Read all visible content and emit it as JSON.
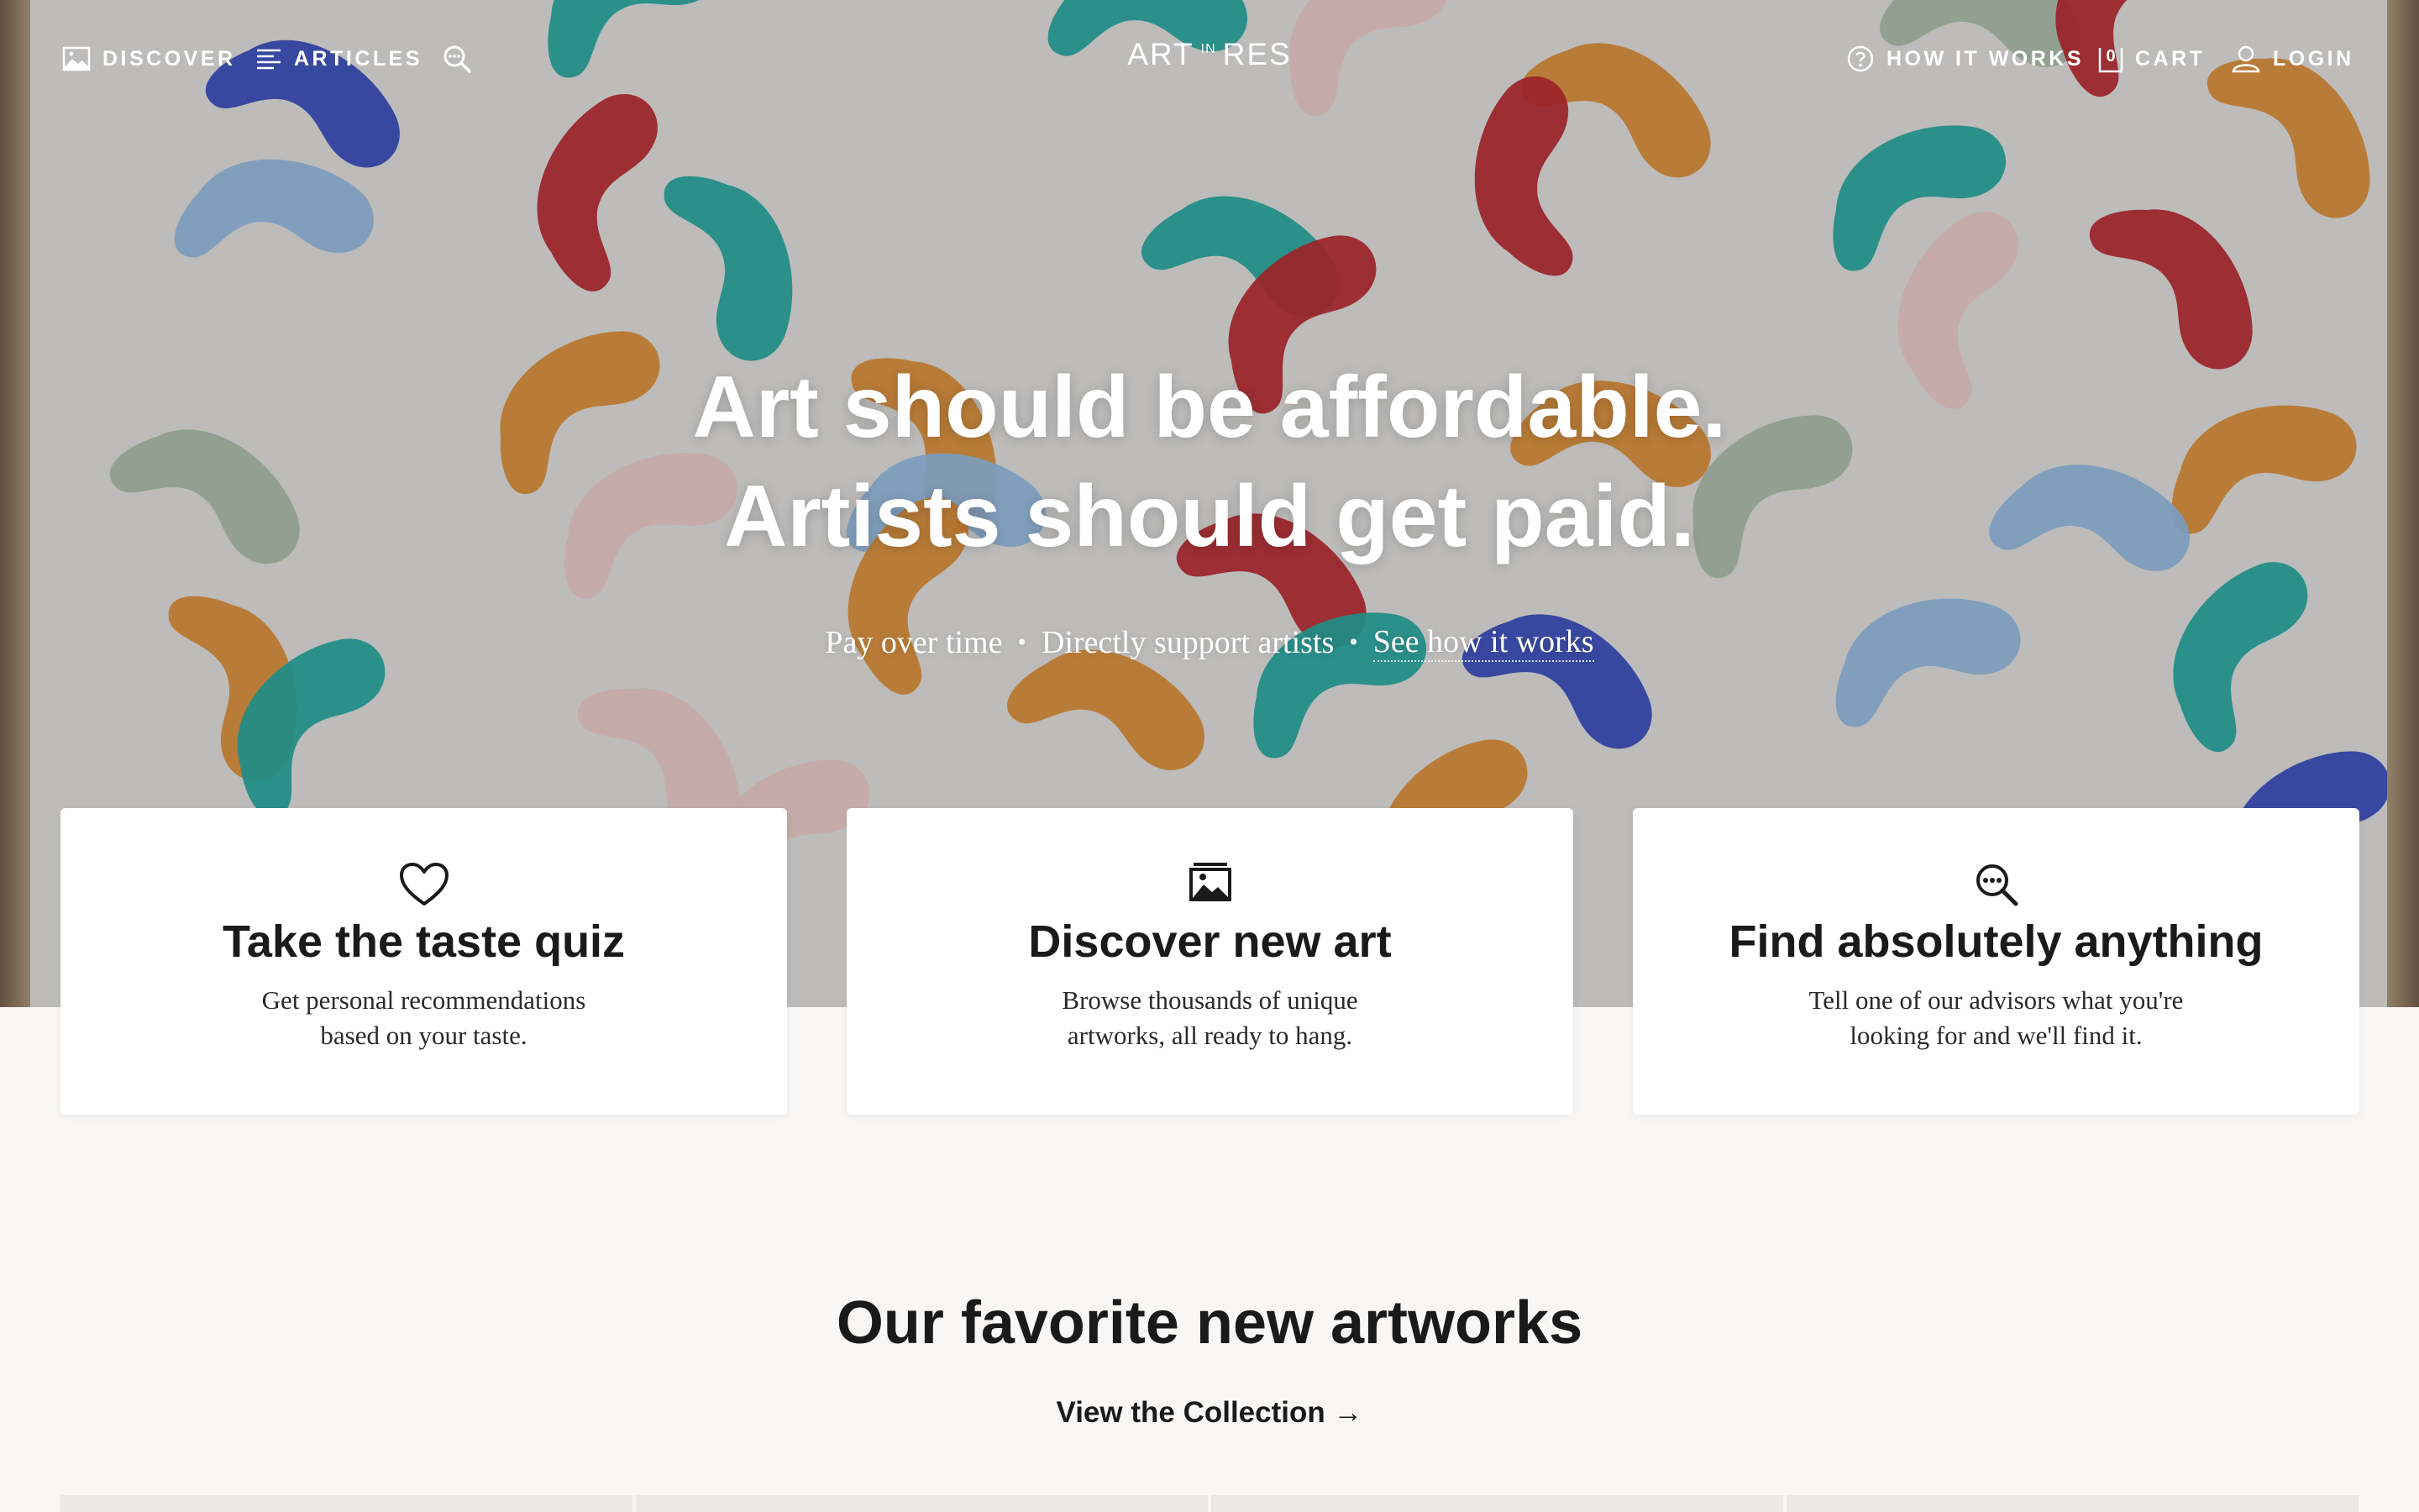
{
  "nav": {
    "discover": "DISCOVER",
    "articles": "ARTICLES",
    "how_it_works": "HOW IT WORKS",
    "cart_count": "0",
    "cart": "CART",
    "login": "LOGIN",
    "icons": [
      "image-icon",
      "menu-lines-icon",
      "search-icon",
      "help-circle-icon",
      "cart-box-icon",
      "user-icon"
    ]
  },
  "logo": {
    "left": "ART",
    "sup": "IN",
    "right": "RES"
  },
  "hero": {
    "line1": "Art should be affordable.",
    "line2": "Artists should get paid.",
    "sub1": "Pay over time",
    "sub2": "Directly support artists",
    "sub3": "See how it works",
    "separator": "•"
  },
  "cards": [
    {
      "icon": "heart-icon",
      "title": "Take the taste quiz",
      "line1": "Get personal recommendations",
      "line2": "based on your taste."
    },
    {
      "icon": "image-icon",
      "title": "Discover new art",
      "line1": "Browse thousands of unique",
      "line2": "artworks, all ready to hang."
    },
    {
      "icon": "search-dots-icon",
      "title": "Find absolutely anything",
      "line1": "Tell one of our advisors what you're",
      "line2": "looking for and we'll find it."
    }
  ],
  "section": {
    "title": "Our favorite new artworks",
    "link": "View the Collection →"
  },
  "colors": {
    "background": "#f8f7f5",
    "card": "#ffffff",
    "text": "#1a1a1a",
    "paint": [
      "#2f45b8",
      "#1fa39b",
      "#d9892f",
      "#b52229",
      "#8fb7df",
      "#e8c7c4",
      "#a6b8a5"
    ]
  }
}
